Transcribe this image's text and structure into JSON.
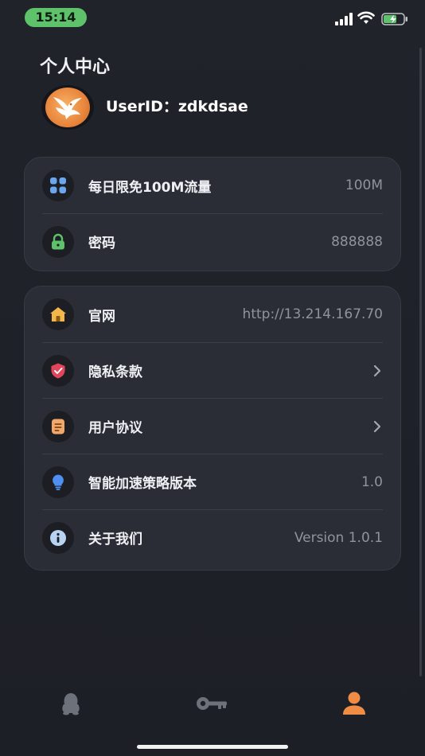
{
  "status_bar": {
    "time": "15:14"
  },
  "header": {
    "title": "个人中心",
    "user_id_label": "UserID：",
    "user_id": "zdkdsae"
  },
  "card_account": {
    "items": [
      {
        "icon": "grid-apps-icon",
        "label": "每日限免100M流量",
        "value": "100M"
      },
      {
        "icon": "lock-icon",
        "label": "密码",
        "value": "888888"
      }
    ]
  },
  "card_info": {
    "items": [
      {
        "icon": "home-icon",
        "label": "官网",
        "value": "http://13.214.167.70"
      },
      {
        "icon": "shield-icon",
        "label": "隐私条款",
        "value": ""
      },
      {
        "icon": "document-icon",
        "label": "用户协议",
        "value": ""
      },
      {
        "icon": "lightbulb-icon",
        "label": "智能加速策略版本",
        "value": "1.0"
      },
      {
        "icon": "info-icon",
        "label": "关于我们",
        "value": "Version 1.0.1"
      }
    ]
  },
  "tab_bar": {
    "tabs": [
      {
        "icon": "penguin-icon",
        "active": false
      },
      {
        "icon": "key-icon",
        "active": false
      },
      {
        "icon": "profile-icon",
        "active": true
      }
    ]
  },
  "colors": {
    "background": "#1f2128",
    "card": "#2a2d35",
    "accent_orange": "#e8853c",
    "status_green": "#5ec26a",
    "muted_text": "#8f939c"
  }
}
